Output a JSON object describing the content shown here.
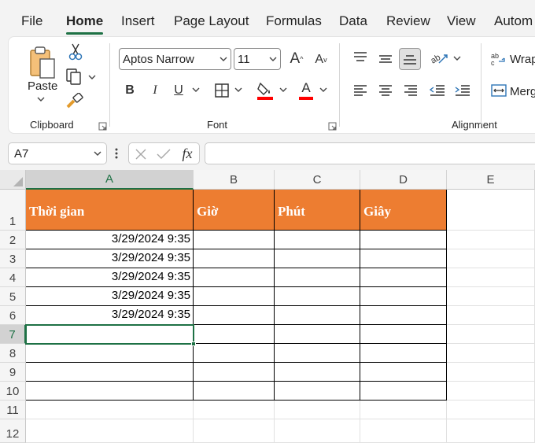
{
  "menu": {
    "tabs": [
      "File",
      "Home",
      "Insert",
      "Page Layout",
      "Formulas",
      "Data",
      "Review",
      "View",
      "Autom"
    ],
    "active": "Home"
  },
  "ribbon": {
    "paste_label": "Paste",
    "font_name": "Aptos Narrow",
    "font_size": "11",
    "grow_font": "A",
    "shrink_font": "A",
    "bold": "B",
    "italic": "I",
    "underline": "U",
    "font_color_glyph": "A",
    "wrap_label": "Wrap",
    "merge_label": "Merg",
    "groups": {
      "clipboard": "Clipboard",
      "font": "Font",
      "alignment": "Alignment"
    },
    "fill_color": "#ff0000",
    "font_color": "#ff0000"
  },
  "formula_bar": {
    "name_box": "A7",
    "fx": "fx",
    "content": ""
  },
  "sheet": {
    "columns": [
      "A",
      "B",
      "C",
      "D",
      "E"
    ],
    "rows": [
      "1",
      "2",
      "3",
      "4",
      "5",
      "6",
      "7",
      "8",
      "9",
      "10",
      "11",
      "12"
    ],
    "headers": [
      "Thời gian",
      "Giờ",
      "Phút",
      "Giây"
    ],
    "dates": [
      "3/29/2024 9:35",
      "3/29/2024 9:35",
      "3/29/2024 9:35",
      "3/29/2024 9:35",
      "3/29/2024 9:35"
    ],
    "selected_cell": "A7",
    "header_fill": "#ed7d31",
    "accent": "#1e7145"
  }
}
